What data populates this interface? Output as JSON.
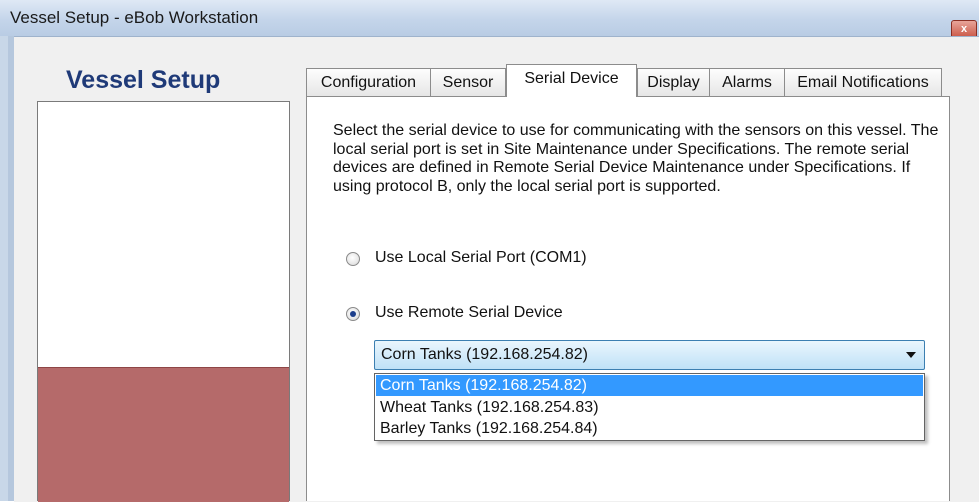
{
  "window": {
    "title": "Vessel Setup - eBob Workstation",
    "close_label": "x"
  },
  "left_panel": {
    "heading": "Vessel Setup"
  },
  "tabs": [
    {
      "label": "Configuration",
      "active": false
    },
    {
      "label": "Sensor",
      "active": false
    },
    {
      "label": "Serial Device",
      "active": true
    },
    {
      "label": "Display",
      "active": false
    },
    {
      "label": "Alarms",
      "active": false
    },
    {
      "label": "Email Notifications",
      "active": false
    }
  ],
  "serial_device": {
    "description": "Select the serial device to use for communicating with the sensors on this vessel. The local serial port is set in Site Maintenance under Specifications. The remote serial devices are defined in Remote Serial Device Maintenance under Specifications.  If using protocol B, only the local serial port is supported.",
    "option_local": {
      "label": "Use Local Serial Port (COM1)",
      "checked": false
    },
    "option_remote": {
      "label": "Use Remote Serial Device",
      "checked": true
    },
    "combo": {
      "selected": "Corn Tanks (192.168.254.82)",
      "options": [
        "Corn Tanks (192.168.254.82)",
        "Wheat Tanks (192.168.254.83)",
        "Barley Tanks (192.168.254.84)"
      ]
    }
  },
  "colors": {
    "accent": "#3399ff",
    "heading": "#1f3a78",
    "preview_fill": "#b56a6a"
  }
}
